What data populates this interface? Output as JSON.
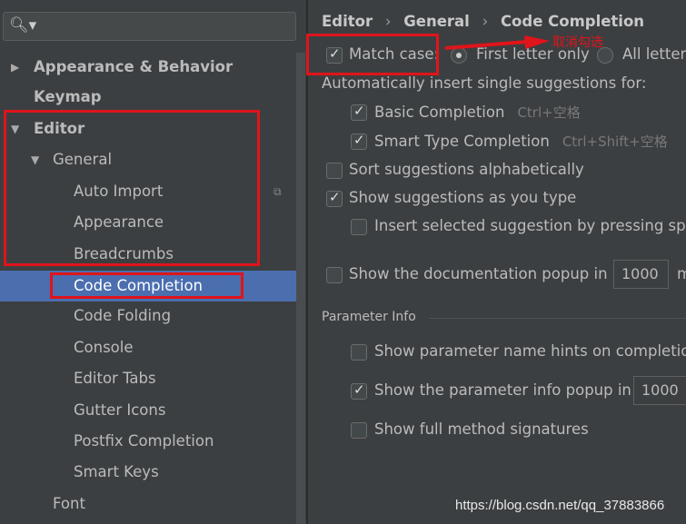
{
  "sidebar": {
    "search_icon": "search-icon",
    "items": [
      {
        "label": "Appearance & Behavior",
        "expanded": false
      },
      {
        "label": "Keymap"
      },
      {
        "label": "Editor",
        "expanded": true
      },
      {
        "label": "General",
        "expanded": true
      },
      {
        "label": "Auto Import"
      },
      {
        "label": "Appearance"
      },
      {
        "label": "Breadcrumbs"
      },
      {
        "label": "Code Completion",
        "selected": true
      },
      {
        "label": "Code Folding"
      },
      {
        "label": "Console"
      },
      {
        "label": "Editor Tabs"
      },
      {
        "label": "Gutter Icons"
      },
      {
        "label": "Postfix Completion"
      },
      {
        "label": "Smart Keys"
      },
      {
        "label": "Font"
      }
    ]
  },
  "breadcrumb": {
    "items": [
      "Editor",
      "General",
      "Code Completion"
    ],
    "separator": "›"
  },
  "settings": {
    "match_case": {
      "label": "Match case:",
      "checked": true
    },
    "first_letter": {
      "label": "First letter only",
      "selected": true
    },
    "all_letters": {
      "label": "All letters",
      "selected": false
    },
    "auto_insert_label": "Automatically insert single suggestions for:",
    "basic": {
      "label": "Basic Completion",
      "shortcut": "Ctrl+空格",
      "checked": true
    },
    "smart": {
      "label": "Smart Type Completion",
      "shortcut": "Ctrl+Shift+空格",
      "checked": true
    },
    "sort": {
      "label": "Sort suggestions alphabetically",
      "checked": false
    },
    "show_as_type": {
      "label": "Show suggestions as you type",
      "checked": true
    },
    "insert_space": {
      "label": "Insert selected suggestion by pressing space",
      "checked": false
    },
    "doc_popup": {
      "label": "Show the documentation popup in",
      "value": "1000",
      "unit": "m",
      "checked": false
    },
    "param_section": "Parameter Info",
    "param_hints": {
      "label": "Show parameter name hints on completion",
      "checked": false
    },
    "param_popup": {
      "label": "Show the parameter info popup in",
      "value": "1000",
      "checked": true
    },
    "full_sig": {
      "label": "Show full method signatures",
      "checked": false
    }
  },
  "annotation": {
    "text": "取消勾选",
    "color": "#e0141b"
  },
  "watermark": "https://blog.csdn.net/qq_37883866",
  "colors": {
    "selection": "#4b6eaf",
    "background": "#3c3f41",
    "highlight": "#e0141b"
  }
}
